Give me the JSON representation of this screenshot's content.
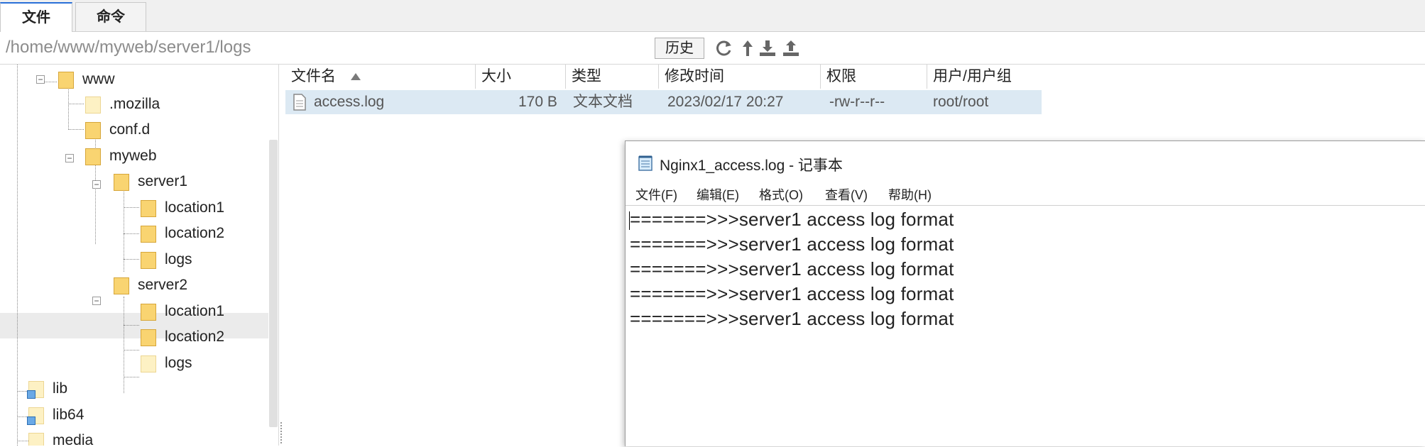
{
  "tabs": [
    {
      "label": "文件",
      "active": true
    },
    {
      "label": "命令",
      "active": false
    }
  ],
  "pathbar": {
    "path": "/home/www/myweb/server1/logs",
    "history_label": "历史",
    "icons": [
      "refresh-icon",
      "up-icon",
      "download-icon",
      "upload-icon"
    ]
  },
  "tree": {
    "nodes": [
      {
        "label": "www",
        "expanded": true,
        "folder": "normal"
      },
      {
        "label": ".mozilla",
        "folder": "pale"
      },
      {
        "label": "conf.d",
        "folder": "normal"
      },
      {
        "label": "myweb",
        "expanded": true,
        "folder": "normal"
      },
      {
        "label": "server1",
        "expanded": true,
        "folder": "normal"
      },
      {
        "label": "location1",
        "folder": "normal"
      },
      {
        "label": "location2",
        "folder": "normal"
      },
      {
        "label": "logs",
        "folder": "normal",
        "selected": true
      },
      {
        "label": "server2",
        "expanded": true,
        "folder": "normal"
      },
      {
        "label": "location1",
        "folder": "normal"
      },
      {
        "label": "location2",
        "folder": "normal"
      },
      {
        "label": "logs",
        "folder": "pale"
      },
      {
        "label": "lib",
        "folder": "link"
      },
      {
        "label": "lib64",
        "folder": "link"
      },
      {
        "label": "media",
        "folder": "pale"
      }
    ]
  },
  "filelist": {
    "columns": [
      "文件名",
      "大小",
      "类型",
      "修改时间",
      "权限",
      "用户/用户组"
    ],
    "sort_column": "文件名",
    "sort_dir": "ascending",
    "rows": [
      {
        "name": "access.log",
        "size": "170 B",
        "type": "文本文档",
        "mtime": "2023/02/17 20:27",
        "perm": "-rw-r--r--",
        "owner": "root/root"
      }
    ]
  },
  "notepad": {
    "title": "Nginx1_access.log - 记事本",
    "menu": [
      "文件(F)",
      "编辑(E)",
      "格式(O)",
      "查看(V)",
      "帮助(H)"
    ],
    "lines": [
      "=======>>>server1 access log format",
      "=======>>>server1 access log format",
      "=======>>>server1 access log format",
      "=======>>>server1 access log format",
      "=======>>>server1 access log format"
    ]
  },
  "colors": {
    "accent": "#2a6fd8",
    "selected_row": "#dce9f3",
    "folder": "#f9d471",
    "tree_highlight": "#ebebeb"
  }
}
